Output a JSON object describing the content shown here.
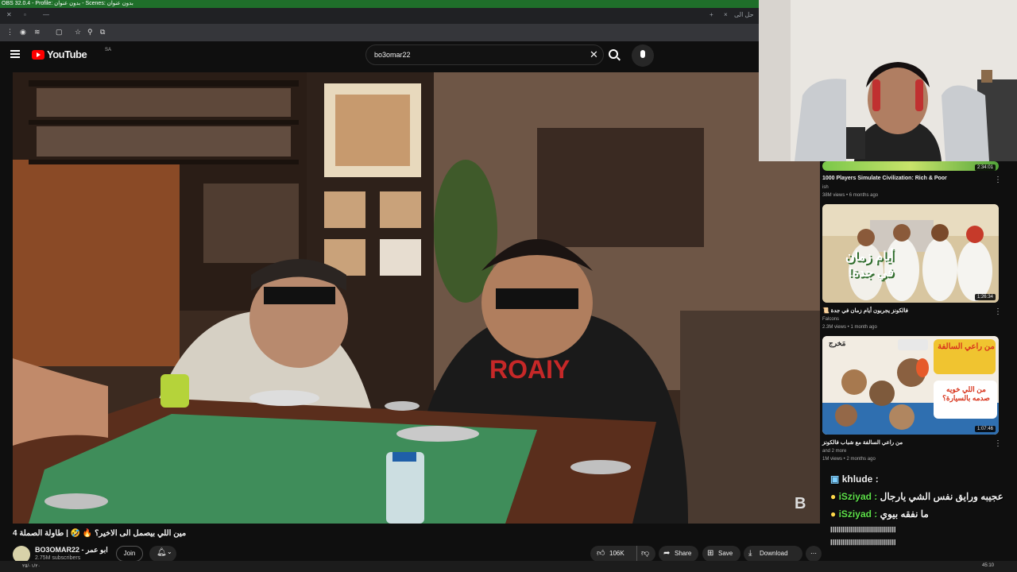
{
  "obs": {
    "title": "OBS 32.0.4 - Profile: بدون عنوان - Scenes: بدون عنوان"
  },
  "browser": {
    "new_tab": "+",
    "close_tab": "×",
    "tab_label": "حل الى"
  },
  "youtube": {
    "logo_text": "YouTube",
    "country": "SA",
    "search_value": "bo3omar22",
    "clear": "✕"
  },
  "video": {
    "title": "مين اللي بيصمل الى الاخير؟ 🔥 🤣 | طاولة الصملة 4",
    "watermark": "B"
  },
  "channel": {
    "name": "BO3OMAR22 - ابو عمر",
    "subscribers": "2.75M subscribers",
    "join": "Join"
  },
  "actions": {
    "likes": "106K",
    "share": "Share",
    "save": "Save",
    "download": "Download",
    "more": "⋯"
  },
  "related": [
    {
      "title": "1000 Players Simulate Civilization: Rich & Poor",
      "channel": "ish",
      "meta": "38M views • 6 months ago",
      "duration": "2:34:01"
    },
    {
      "title": "فالكونز يجربون أيام زمان في جدة 📜",
      "channel": "Falcons",
      "meta": "2.3M views • 1 month ago",
      "duration": "1:26:34",
      "thumb_text": "أيام زمان في جدة!"
    },
    {
      "title": "من راعي السالفة مع شباب فالكونز",
      "channel": "and 2 more",
      "meta": "1M views • 2 months ago",
      "duration": "1:07:46",
      "thumb_text_top": "من راعي السالفة",
      "thumb_text_bottom": "من اللي خويه صدمه بالسيارة؟",
      "thumb_brand": "مَخرج"
    }
  ],
  "chat": [
    {
      "user": "khlude :",
      "message": ""
    },
    {
      "user": "iSziyad :",
      "message": "عجيبه ورايق نفس الشي يارجال"
    },
    {
      "user": "iSziyad :",
      "message": "ما نفقه بيوي"
    }
  ],
  "chat_spam": "ااااااااااااااااااااااااااااااااا",
  "taskbar": {
    "time": "45:10",
    "date": "٢٥/٠١/٢٠"
  }
}
